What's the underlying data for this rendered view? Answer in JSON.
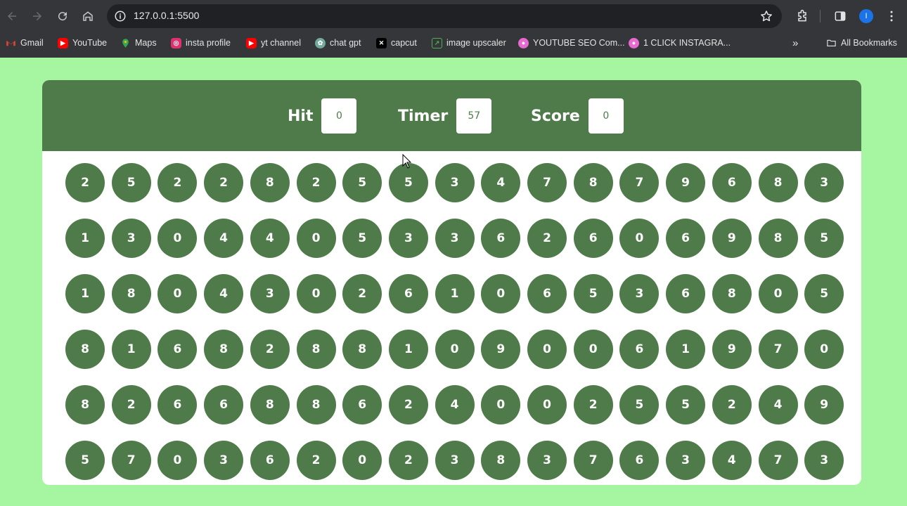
{
  "browser": {
    "url": "127.0.0.1:5500",
    "bookmarks": [
      {
        "label": "Gmail",
        "icon": "gmail-icon",
        "color": "#ea4335"
      },
      {
        "label": "YouTube",
        "icon": "youtube-icon",
        "color": "#ff0000"
      },
      {
        "label": "Maps",
        "icon": "maps-icon",
        "color": "#34a853"
      },
      {
        "label": "insta profile",
        "icon": "instagram-icon",
        "color": "#e1306c"
      },
      {
        "label": "yt channel",
        "icon": "youtube-icon",
        "color": "#ff0000"
      },
      {
        "label": "chat gpt",
        "icon": "chatgpt-icon",
        "color": "#74aa9c"
      },
      {
        "label": "capcut",
        "icon": "capcut-icon",
        "color": "#000000"
      },
      {
        "label": "image upscaler",
        "icon": "image-upscaler-icon",
        "color": "#2e7d32"
      },
      {
        "label": "YOUTUBE SEO Com...",
        "icon": "seo-icon",
        "color": "#e86ad1"
      },
      {
        "label": "1 CLICK INSTAGRA...",
        "icon": "instagra-icon",
        "color": "#e86ad1"
      }
    ],
    "all_bookmarks": "All Bookmarks",
    "profile_initial": "I"
  },
  "game": {
    "hit_label": "Hit",
    "hit_value": "0",
    "timer_label": "Timer",
    "timer_value": "57",
    "score_label": "Score",
    "score_value": "0",
    "accent_color": "#4f7b4a",
    "background_color": "#a6f5a0",
    "rows": [
      [
        "2",
        "5",
        "2",
        "2",
        "8",
        "2",
        "5",
        "5",
        "3",
        "4",
        "7",
        "8",
        "7",
        "9",
        "6",
        "8",
        "3"
      ],
      [
        "1",
        "3",
        "0",
        "4",
        "4",
        "0",
        "5",
        "3",
        "3",
        "6",
        "2",
        "6",
        "0",
        "6",
        "9",
        "8",
        "5"
      ],
      [
        "1",
        "8",
        "0",
        "4",
        "3",
        "0",
        "2",
        "6",
        "1",
        "0",
        "6",
        "5",
        "3",
        "6",
        "8",
        "0",
        "5"
      ],
      [
        "8",
        "1",
        "6",
        "8",
        "2",
        "8",
        "8",
        "1",
        "0",
        "9",
        "0",
        "0",
        "6",
        "1",
        "9",
        "7",
        "0"
      ],
      [
        "8",
        "2",
        "6",
        "6",
        "8",
        "8",
        "6",
        "2",
        "4",
        "0",
        "0",
        "2",
        "5",
        "5",
        "2",
        "4",
        "9"
      ],
      [
        "5",
        "7",
        "0",
        "3",
        "6",
        "2",
        "0",
        "2",
        "3",
        "8",
        "3",
        "7",
        "6",
        "3",
        "4",
        "7",
        "3"
      ]
    ]
  }
}
